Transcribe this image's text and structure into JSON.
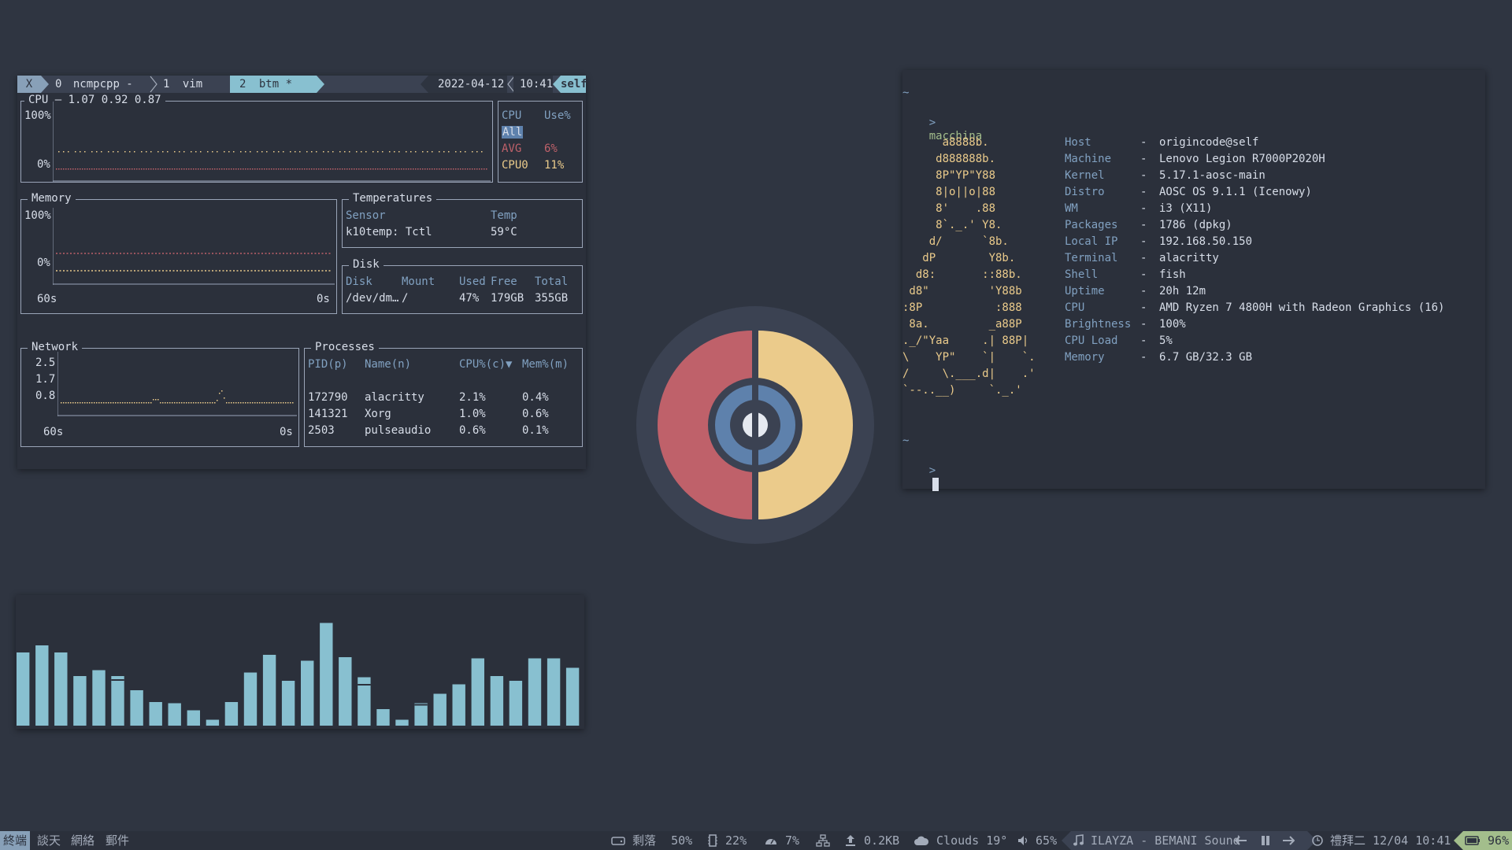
{
  "tmux": {
    "close": "X",
    "windows": [
      {
        "index": "0",
        "name": "ncmpcpp -"
      },
      {
        "index": "1",
        "name": "vim"
      },
      {
        "index": "2",
        "name": "btm *"
      }
    ],
    "date": "2022-04-12",
    "time": "10:41",
    "host": "self"
  },
  "btm": {
    "cpu": {
      "title": "CPU — 1.07 0.92 0.87",
      "y_top": "100%",
      "y_bottom": "0%",
      "legend_headers": [
        "CPU",
        "Use%"
      ],
      "legend": [
        {
          "name": "All",
          "use": ""
        },
        {
          "name": "AVG",
          "use": "6%"
        },
        {
          "name": "CPU0",
          "use": "11%"
        }
      ]
    },
    "memory": {
      "title": "Memory",
      "y_top": "100%",
      "y_bottom": "0%",
      "x_left": "60s",
      "x_right": "0s"
    },
    "temperatures": {
      "title": "Temperatures",
      "headers": [
        "Sensor",
        "Temp"
      ],
      "rows": [
        [
          "k10temp: Tctl",
          "59°C"
        ]
      ]
    },
    "disk": {
      "title": "Disk",
      "headers": [
        "Disk",
        "Mount",
        "Used",
        "Free",
        "Total"
      ],
      "rows": [
        [
          "/dev/dm…",
          "/",
          "47%",
          "179GB",
          "355GB"
        ]
      ]
    },
    "network": {
      "title": "Network",
      "y_labels": [
        "2.5",
        "1.7",
        "0.8"
      ],
      "x_left": "60s",
      "x_right": "0s"
    },
    "processes": {
      "title": "Processes",
      "headers": [
        "PID(p)",
        "Name(n)",
        "CPU%(c)▼",
        "Mem%(m)"
      ],
      "rows": [
        [
          "172790",
          "alacritty",
          "2.1%",
          "0.4%"
        ],
        [
          "141321",
          "Xorg",
          "1.0%",
          "0.6%"
        ],
        [
          "2503",
          "pulseaudio",
          "0.6%",
          "0.1%"
        ]
      ]
    }
  },
  "terminal": {
    "tilde": "~",
    "prompt": ">",
    "command": "macchina",
    "art": [
      "      a8888b.",
      "     d888888b.",
      "     8P\"YP\"Y88",
      "     8|o||o|88",
      "     8'    .88",
      "     8`._.' Y8.",
      "    d/      `8b.",
      "   dP        Y8b.",
      "  d8:       ::88b.",
      " d8\"         'Y88b",
      ":8P           :888",
      " 8a.         _a88P",
      "._/\"Yaa     .| 88P|",
      "\\    YP\"    `|    `.",
      "/     \\.___.d|    .'",
      "`--..__)     `._.'"
    ],
    "info": [
      {
        "key": "Host",
        "value": "origincode@self"
      },
      {
        "key": "Machine",
        "value": "Lenovo Legion R7000P2020H"
      },
      {
        "key": "Kernel",
        "value": "5.17.1-aosc-main"
      },
      {
        "key": "Distro",
        "value": "AOSC OS 9.1.1 (Icenowy)"
      },
      {
        "key": "WM",
        "value": "i3 (X11)"
      },
      {
        "key": "Packages",
        "value": "1786 (dpkg)"
      },
      {
        "key": "Local IP",
        "value": "192.168.50.150"
      },
      {
        "key": "Terminal",
        "value": "alacritty"
      },
      {
        "key": "Shell",
        "value": "fish"
      },
      {
        "key": "Uptime",
        "value": "20h 12m"
      },
      {
        "key": "CPU",
        "value": "AMD Ryzen 7 4800H with Radeon Graphics (16)"
      },
      {
        "key": "Brightness",
        "value": "100%"
      },
      {
        "key": "CPU Load",
        "value": "5%"
      },
      {
        "key": "Memory",
        "value": "6.7 GB/32.3 GB"
      }
    ],
    "separator": "-"
  },
  "visualizer": {
    "bar_color": "#88c0d0",
    "levels": [
      0.62,
      0.68,
      0.62,
      0.42,
      0.47,
      0.42,
      0.3,
      0.2,
      0.19,
      0.13,
      0.05,
      0.2,
      0.45,
      0.6,
      0.38,
      0.55,
      0.87,
      0.58,
      0.41,
      0.14,
      0.05,
      0.19,
      0.27,
      0.35,
      0.57,
      0.42,
      0.38,
      0.57,
      0.57,
      0.49
    ],
    "peaks": [
      0.62,
      0.68,
      0.62,
      0.42,
      0.47,
      0.38,
      0.3,
      0.2,
      0.19,
      0.13,
      0.05,
      0.2,
      0.45,
      0.6,
      0.38,
      0.55,
      0.87,
      0.58,
      0.34,
      0.14,
      0.05,
      0.17,
      0.27,
      0.35,
      0.57,
      0.42,
      0.38,
      0.57,
      0.57,
      0.52
    ]
  },
  "statusbar": {
    "workspaces": [
      "終端",
      "談天",
      "網絡",
      "郵件"
    ],
    "disk": "剩落",
    "disk_pct": "50%",
    "mem": "22%",
    "cpu": "7%",
    "net": "0.2KB",
    "weather": "Clouds 19°",
    "volume": "65%",
    "music": "ILAYZA - BEMANI Sound",
    "clock": "禮拜二 12/04 10:41",
    "battery": "96%"
  },
  "colors": {
    "red": "#bf616a",
    "yellow": "#ebcb8b",
    "blue": "#5e81ac",
    "accent": "#88c0d0"
  }
}
